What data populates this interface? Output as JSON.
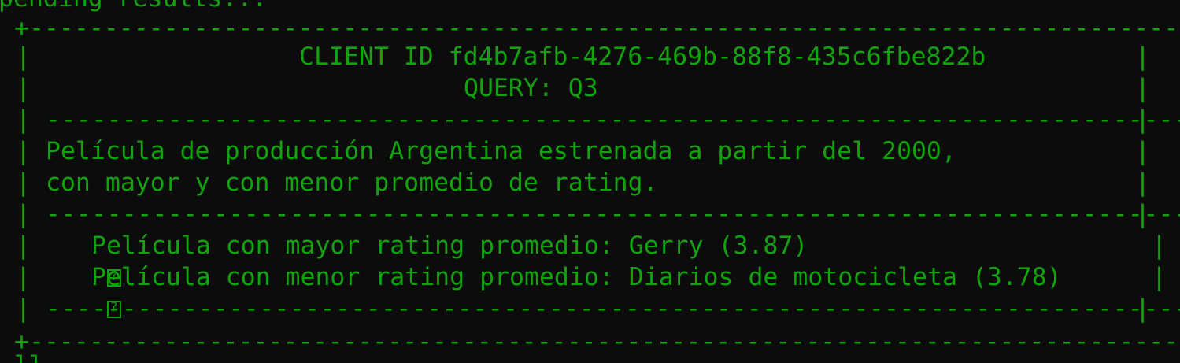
{
  "terminal": {
    "top_status": "pending results...",
    "bottom_status": "ll"
  },
  "frame": {
    "border_top": "+----------------------------------------------------------------------------------+",
    "border_bottom": "+----------------------------------------------------------------------------------+",
    "separator": "-----------------------------------------------------------------------------------",
    "pipe": "|"
  },
  "header": {
    "client_label": "CLIENT ID fd4b7afb-4276-469b-88f8-435c6fbe822b",
    "query_label": "QUERY: Q3"
  },
  "description": {
    "line1": "Película de producción Argentina estrenada a partir del 2000,",
    "line2": "con mayor y con menor promedio de rating."
  },
  "results": [
    {
      "icon": "missing-glyph-icon",
      "text": "Película con mayor rating promedio: Gerry (3.87)"
    },
    {
      "icon": "missing-glyph-icon",
      "text": "Película con menor rating promedio: Diarios de motocicleta (3.78)"
    }
  ],
  "colors": {
    "background": "#0c0c0c",
    "foreground": "#13a10e"
  }
}
